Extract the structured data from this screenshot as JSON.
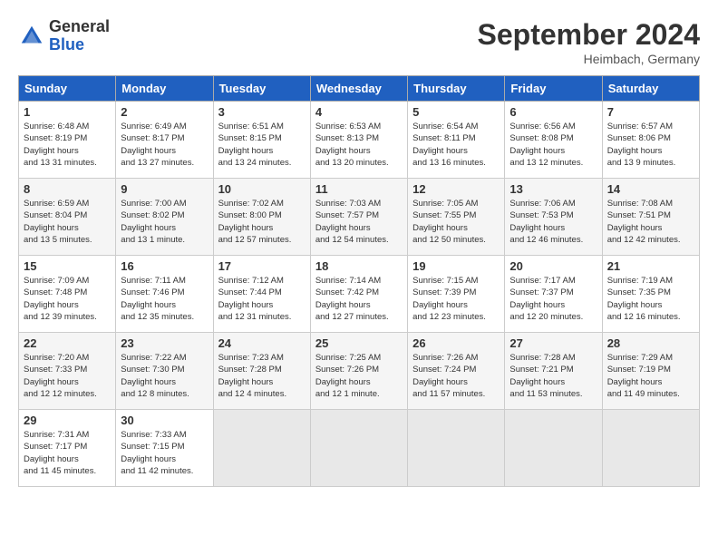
{
  "header": {
    "logo_general": "General",
    "logo_blue": "Blue",
    "month_year": "September 2024",
    "location": "Heimbach, Germany"
  },
  "days_of_week": [
    "Sunday",
    "Monday",
    "Tuesday",
    "Wednesday",
    "Thursday",
    "Friday",
    "Saturday"
  ],
  "weeks": [
    [
      {
        "day": 1,
        "sunrise": "6:48 AM",
        "sunset": "8:19 PM",
        "daylight": "13 hours and 31 minutes."
      },
      {
        "day": 2,
        "sunrise": "6:49 AM",
        "sunset": "8:17 PM",
        "daylight": "13 hours and 27 minutes."
      },
      {
        "day": 3,
        "sunrise": "6:51 AM",
        "sunset": "8:15 PM",
        "daylight": "13 hours and 24 minutes."
      },
      {
        "day": 4,
        "sunrise": "6:53 AM",
        "sunset": "8:13 PM",
        "daylight": "13 hours and 20 minutes."
      },
      {
        "day": 5,
        "sunrise": "6:54 AM",
        "sunset": "8:11 PM",
        "daylight": "13 hours and 16 minutes."
      },
      {
        "day": 6,
        "sunrise": "6:56 AM",
        "sunset": "8:08 PM",
        "daylight": "13 hours and 12 minutes."
      },
      {
        "day": 7,
        "sunrise": "6:57 AM",
        "sunset": "8:06 PM",
        "daylight": "13 hours and 9 minutes."
      }
    ],
    [
      {
        "day": 8,
        "sunrise": "6:59 AM",
        "sunset": "8:04 PM",
        "daylight": "13 hours and 5 minutes."
      },
      {
        "day": 9,
        "sunrise": "7:00 AM",
        "sunset": "8:02 PM",
        "daylight": "13 hours and 1 minute."
      },
      {
        "day": 10,
        "sunrise": "7:02 AM",
        "sunset": "8:00 PM",
        "daylight": "12 hours and 57 minutes."
      },
      {
        "day": 11,
        "sunrise": "7:03 AM",
        "sunset": "7:57 PM",
        "daylight": "12 hours and 54 minutes."
      },
      {
        "day": 12,
        "sunrise": "7:05 AM",
        "sunset": "7:55 PM",
        "daylight": "12 hours and 50 minutes."
      },
      {
        "day": 13,
        "sunrise": "7:06 AM",
        "sunset": "7:53 PM",
        "daylight": "12 hours and 46 minutes."
      },
      {
        "day": 14,
        "sunrise": "7:08 AM",
        "sunset": "7:51 PM",
        "daylight": "12 hours and 42 minutes."
      }
    ],
    [
      {
        "day": 15,
        "sunrise": "7:09 AM",
        "sunset": "7:48 PM",
        "daylight": "12 hours and 39 minutes."
      },
      {
        "day": 16,
        "sunrise": "7:11 AM",
        "sunset": "7:46 PM",
        "daylight": "12 hours and 35 minutes."
      },
      {
        "day": 17,
        "sunrise": "7:12 AM",
        "sunset": "7:44 PM",
        "daylight": "12 hours and 31 minutes."
      },
      {
        "day": 18,
        "sunrise": "7:14 AM",
        "sunset": "7:42 PM",
        "daylight": "12 hours and 27 minutes."
      },
      {
        "day": 19,
        "sunrise": "7:15 AM",
        "sunset": "7:39 PM",
        "daylight": "12 hours and 23 minutes."
      },
      {
        "day": 20,
        "sunrise": "7:17 AM",
        "sunset": "7:37 PM",
        "daylight": "12 hours and 20 minutes."
      },
      {
        "day": 21,
        "sunrise": "7:19 AM",
        "sunset": "7:35 PM",
        "daylight": "12 hours and 16 minutes."
      }
    ],
    [
      {
        "day": 22,
        "sunrise": "7:20 AM",
        "sunset": "7:33 PM",
        "daylight": "12 hours and 12 minutes."
      },
      {
        "day": 23,
        "sunrise": "7:22 AM",
        "sunset": "7:30 PM",
        "daylight": "12 hours and 8 minutes."
      },
      {
        "day": 24,
        "sunrise": "7:23 AM",
        "sunset": "7:28 PM",
        "daylight": "12 hours and 4 minutes."
      },
      {
        "day": 25,
        "sunrise": "7:25 AM",
        "sunset": "7:26 PM",
        "daylight": "12 hours and 1 minute."
      },
      {
        "day": 26,
        "sunrise": "7:26 AM",
        "sunset": "7:24 PM",
        "daylight": "11 hours and 57 minutes."
      },
      {
        "day": 27,
        "sunrise": "7:28 AM",
        "sunset": "7:21 PM",
        "daylight": "11 hours and 53 minutes."
      },
      {
        "day": 28,
        "sunrise": "7:29 AM",
        "sunset": "7:19 PM",
        "daylight": "11 hours and 49 minutes."
      }
    ],
    [
      {
        "day": 29,
        "sunrise": "7:31 AM",
        "sunset": "7:17 PM",
        "daylight": "11 hours and 45 minutes."
      },
      {
        "day": 30,
        "sunrise": "7:33 AM",
        "sunset": "7:15 PM",
        "daylight": "11 hours and 42 minutes."
      },
      null,
      null,
      null,
      null,
      null
    ]
  ]
}
